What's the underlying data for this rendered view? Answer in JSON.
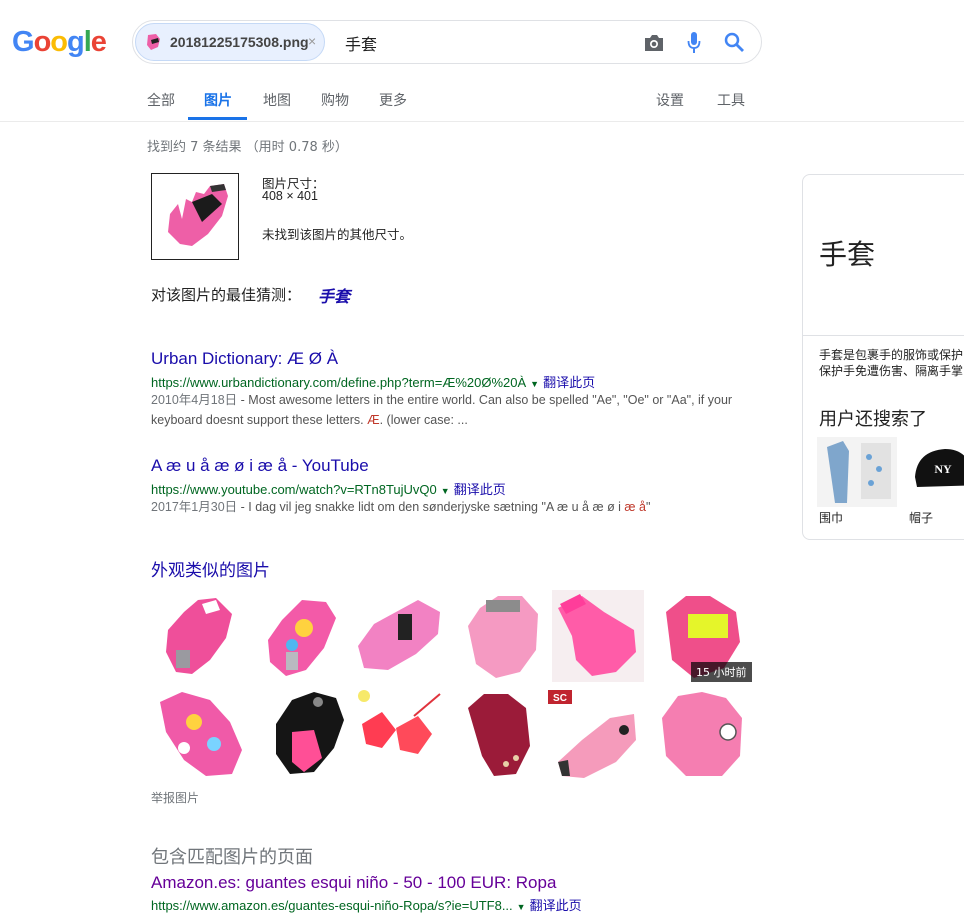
{
  "logo": {
    "letters": [
      "G",
      "o",
      "o",
      "g",
      "l",
      "e"
    ]
  },
  "search": {
    "chip_filename": "20181225175308.png",
    "query": "手套"
  },
  "tabs": [
    "全部",
    "图片",
    "地图",
    "购物",
    "更多"
  ],
  "tools": [
    "设置",
    "工具"
  ],
  "result_stats": "找到约 7 条结果  （用时 0.78 秒）",
  "query_image": {
    "size_label": "图片尺寸：",
    "size_value": "408 × 401",
    "no_other_sizes": "未找到该图片的其他尺寸。"
  },
  "best_guess": {
    "label": "对该图片的最佳猜测：",
    "value": "手套"
  },
  "results": [
    {
      "title": "Urban Dictionary: Æ Ø À",
      "url": "https://www.urbandictionary.com/define.php?term=Æ%20Ø%20À",
      "translate": "翻译此页",
      "date": "2010年4月18日",
      "snippet_pre": " - Most awesome letters in the entire world. Can also be spelled \"Ae\", \"Oe\" or \"Aa\", if your keyboard doesnt support these letters. ",
      "snippet_em": "Æ",
      "snippet_post": ". (lower case: ..."
    },
    {
      "title": "A æ u å æ ø i æ å - YouTube",
      "url": "https://www.youtube.com/watch?v=RTn8TujUvQ0",
      "translate": "翻译此页",
      "date": "2017年1月30日",
      "snippet_pre": " - I dag vil jeg snakke lidt om den sønderjyske sætning \"A æ u å æ ø i ",
      "snippet_em": "æ å",
      "snippet_post": "\""
    }
  ],
  "similar_images": {
    "title": "外观类似的图片",
    "time_badge": "15 小时前",
    "report": "举报图片"
  },
  "pages_with_image": {
    "title": "包含匹配图片的页面",
    "first_title": "Amazon.es: guantes esqui niño - 50 - 100 EUR: Ropa",
    "first_url": "https://www.amazon.es/guantes-esqui-niño-Ropa/s?ie=UTF8...",
    "first_translate": "翻译此页"
  },
  "knowledge_panel": {
    "title": "手套",
    "description": "手套是包裹手的服饰或保护\n保护手免遭伤害、隔离手掌",
    "also_searched": "用户还搜索了",
    "items": [
      "围巾",
      "帽子"
    ]
  },
  "colors": {
    "link": "#1a0dab",
    "url": "#006621",
    "accent": "#1a73e8",
    "glove_pink": "#ee5fa7"
  }
}
